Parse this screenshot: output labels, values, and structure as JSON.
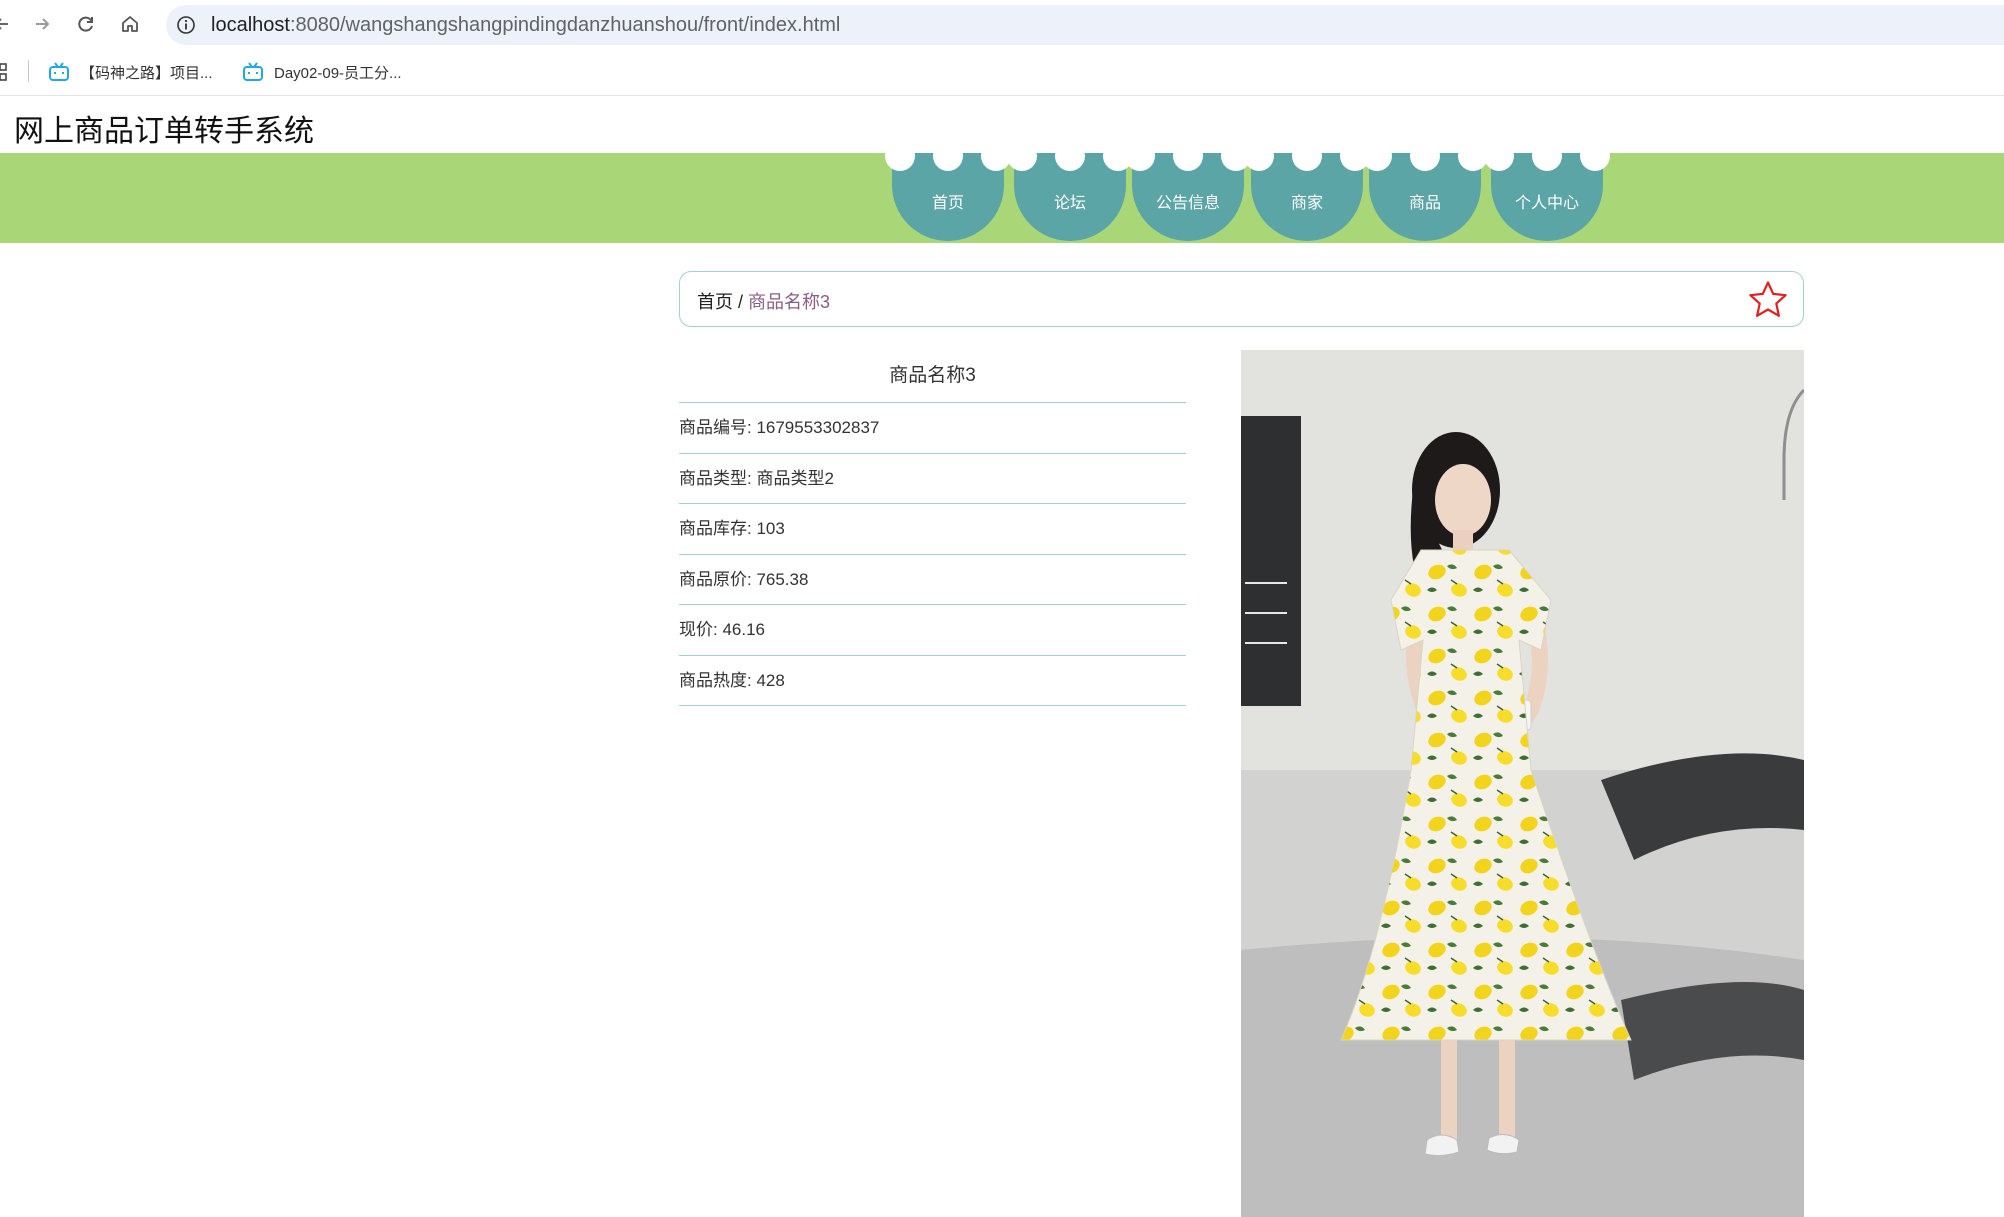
{
  "browser": {
    "url_host": "localhost",
    "url_rest": ":8080/wangshangshangpindingdanzhuanshou/front/index.html",
    "bookmarks": [
      {
        "label": "【码神之路】项目...",
        "icon": "bilibili-icon"
      },
      {
        "label": "Day02-09-员工分...",
        "icon": "bilibili-icon"
      }
    ]
  },
  "site": {
    "title": "网上商品订单转手系统"
  },
  "nav": {
    "items": [
      {
        "label": "首页"
      },
      {
        "label": "论坛"
      },
      {
        "label": "公告信息"
      },
      {
        "label": "商家"
      },
      {
        "label": "商品"
      },
      {
        "label": "个人中心"
      }
    ]
  },
  "breadcrumb": {
    "home": "首页",
    "separator": "/",
    "current": "商品名称3"
  },
  "product": {
    "name": "商品名称3",
    "fields": [
      {
        "text": "商品编号: 1679553302837"
      },
      {
        "text": "商品类型: 商品类型2"
      },
      {
        "text": "商品库存: 103"
      },
      {
        "text": "商品原价: 765.38"
      },
      {
        "text": "现价: 46.16"
      },
      {
        "text": "商品热度: 428"
      }
    ]
  },
  "colors": {
    "nav_band": "#a9d676",
    "nav_tab": "#5ba5a7",
    "border_accent": "#a5cfd1",
    "breadcrumb_current": "#8a5d86",
    "star": "#e02020"
  }
}
